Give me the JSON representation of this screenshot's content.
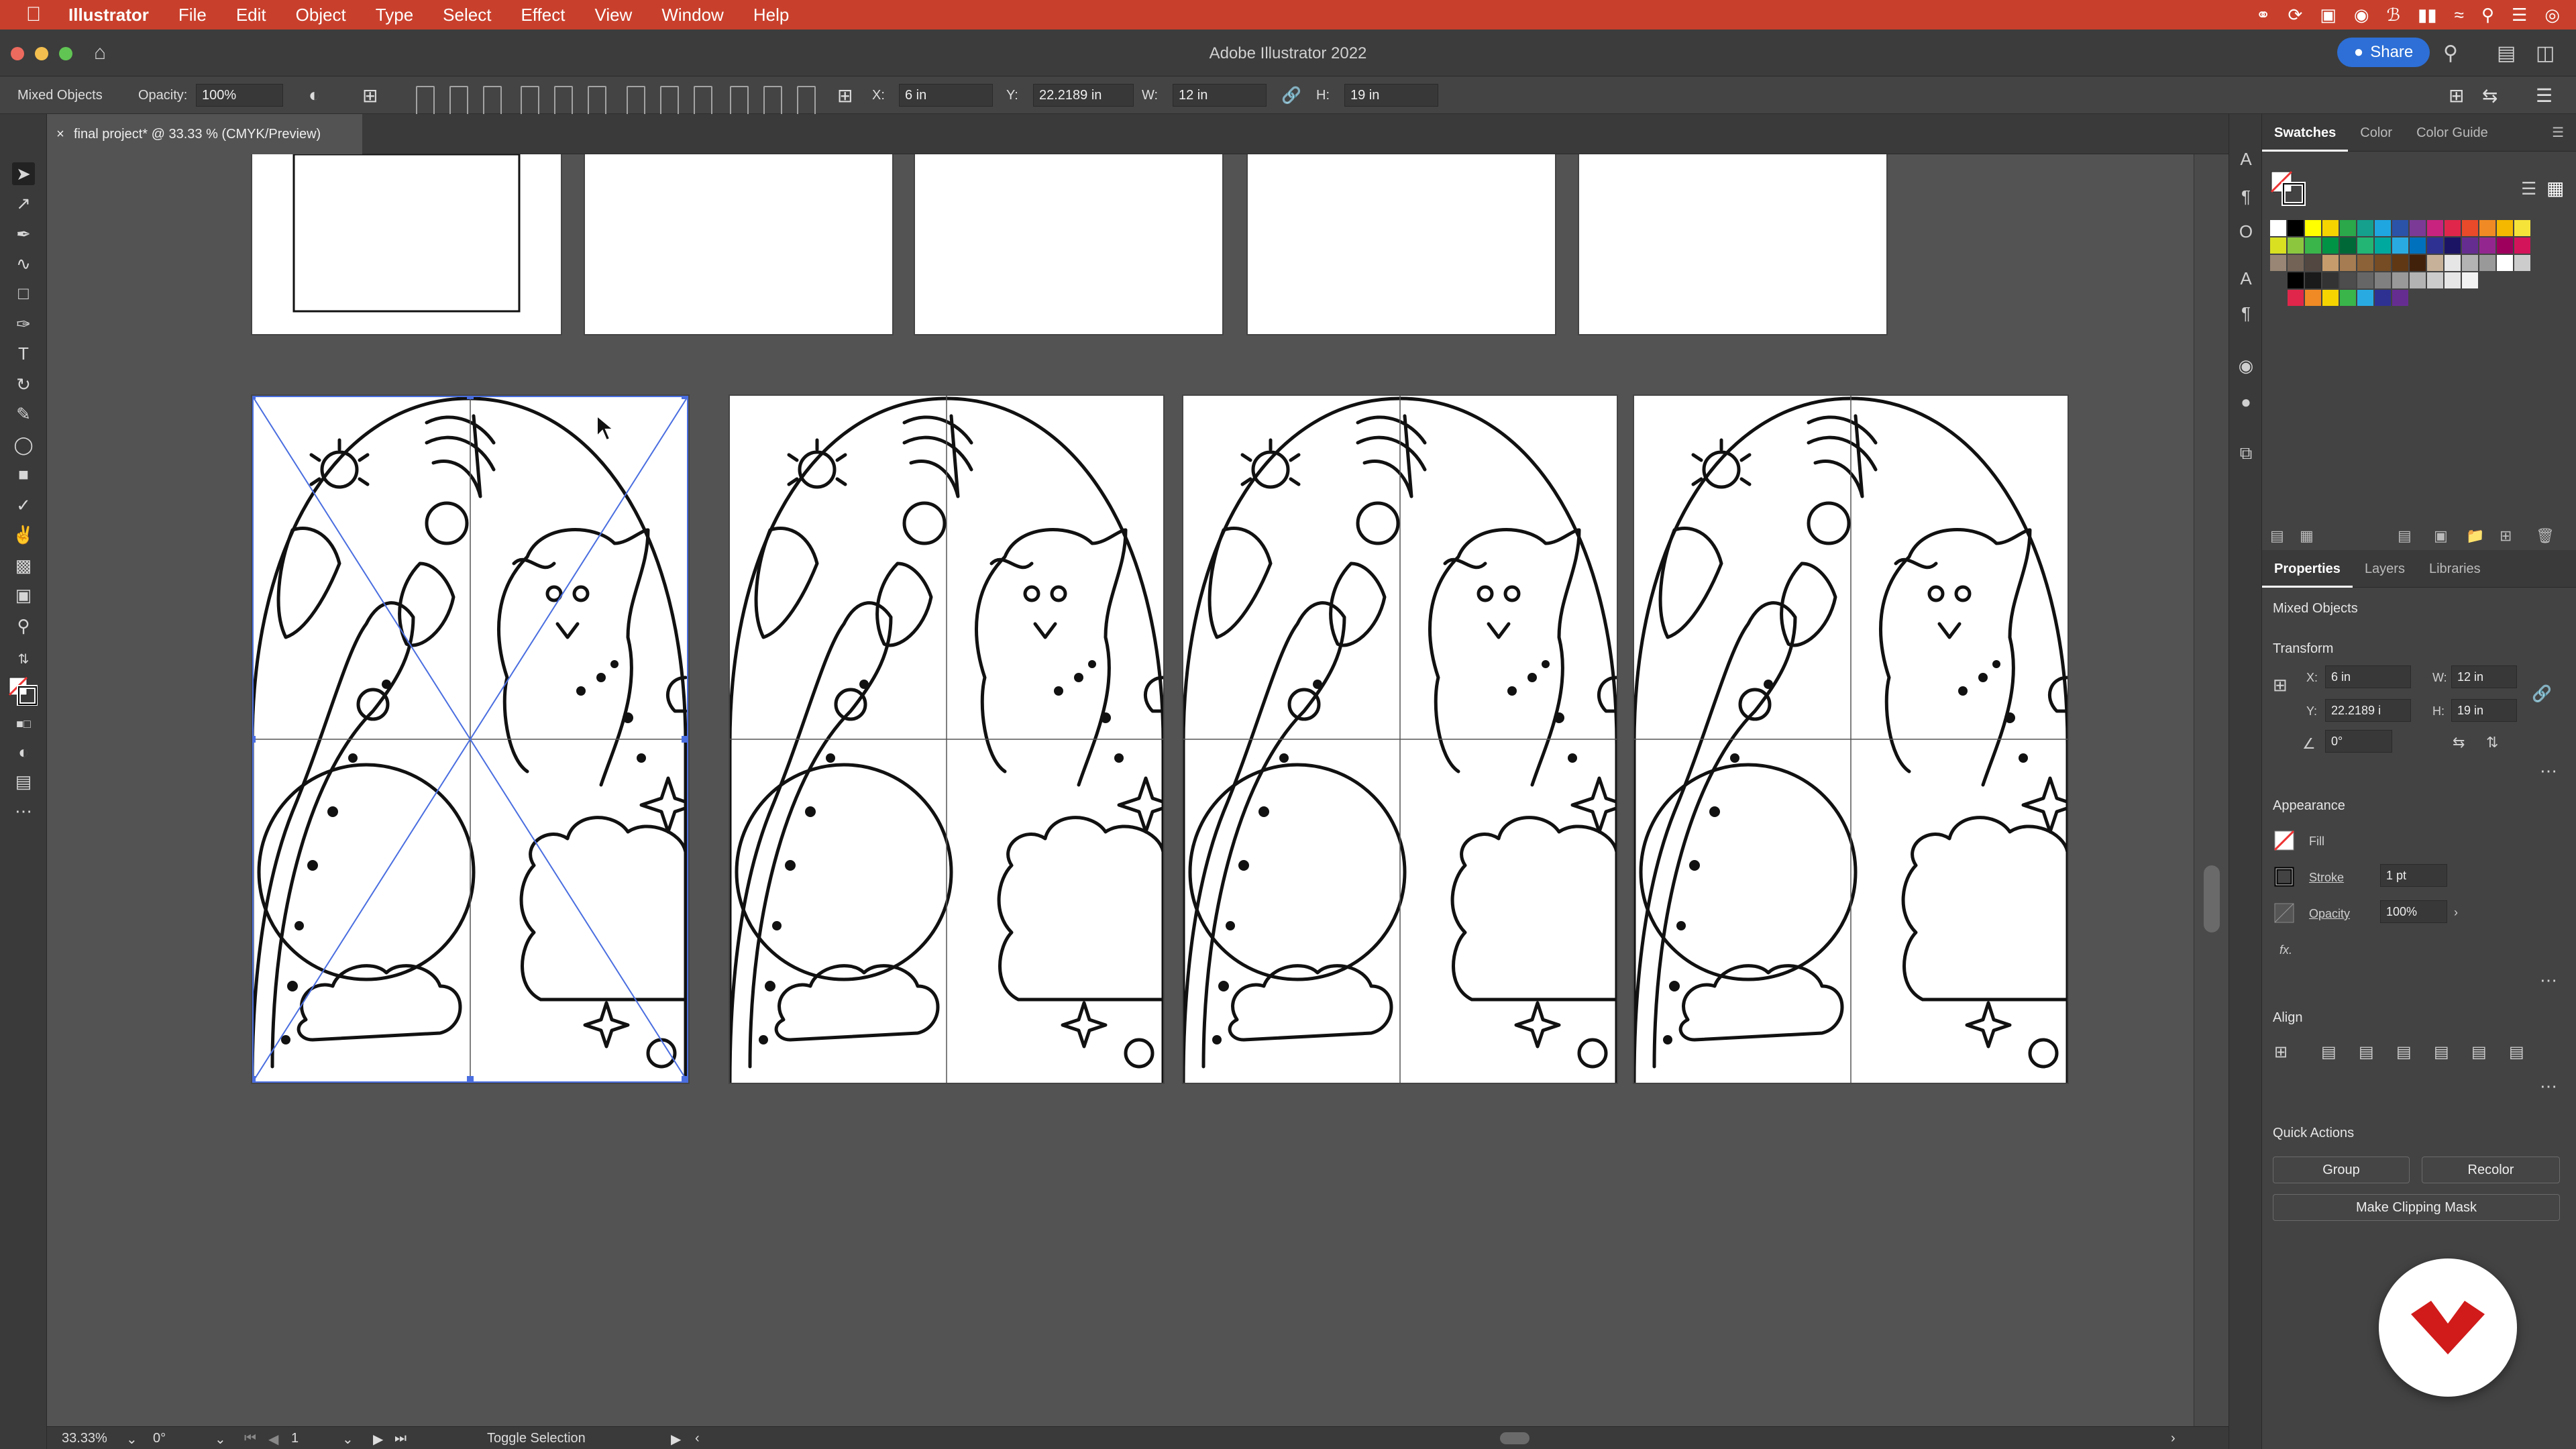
{
  "menubar": {
    "app_name": "Illustrator",
    "items": [
      "File",
      "Edit",
      "Object",
      "Type",
      "Select",
      "Effect",
      "View",
      "Window",
      "Help"
    ]
  },
  "titlebar": {
    "title": "Adobe Illustrator 2022",
    "share_label": "Share"
  },
  "controlbar": {
    "selection_type": "Mixed Objects",
    "opacity_label": "Opacity:",
    "opacity_value": "100%",
    "x_label": "X:",
    "x_value": "6 in",
    "y_label": "Y:",
    "y_value": "22.2189 in",
    "w_label": "W:",
    "w_value": "12 in",
    "h_label": "H:",
    "h_value": "19 in"
  },
  "document": {
    "tab_title": "final project* @ 33.33 % (CMYK/Preview)"
  },
  "swatches_panel": {
    "tabs": [
      "Swatches",
      "Color",
      "Color Guide"
    ],
    "active_tab": "Swatches",
    "colors_row1": [
      "#ffffff",
      "#000000",
      "#ffff00",
      "#f5d400",
      "#2aa84a",
      "#14a08c",
      "#1fa6e0",
      "#2b53a8",
      "#7b3a96",
      "#c8237e",
      "#e0264a",
      "#e84a2a",
      "#f08a24",
      "#f5b800",
      "#f6e33a"
    ],
    "colors_row2": [
      "#d9e021",
      "#8cc63f",
      "#39b54a",
      "#009245",
      "#006837",
      "#22b573",
      "#00a99d",
      "#29abe2",
      "#0071bc",
      "#2e3192",
      "#1b1464",
      "#662d91",
      "#93278f",
      "#9e005d",
      "#d4145a"
    ],
    "colors_row3": [
      "#998675",
      "#736357",
      "#534741",
      "#c69c6d",
      "#a67c52",
      "#8c6239",
      "#754c24",
      "#603813",
      "#42210b",
      "#c7b299",
      "#e6e6e6",
      "#b3b3b3",
      "#999999",
      "#ffffff",
      "#cccccc"
    ],
    "colors_row4": [
      "#000000",
      "#1a1a1a",
      "#333333",
      "#4d4d4d",
      "#666666",
      "#808080",
      "#999999",
      "#b3b3b3",
      "#cccccc",
      "#e6e6e6",
      "#f2f2f2"
    ],
    "colors_row5": [
      "#e0264a",
      "#f08a24",
      "#f5d400",
      "#39b54a",
      "#29abe2",
      "#2e3192",
      "#662d91"
    ]
  },
  "properties_panel": {
    "tabs": [
      "Properties",
      "Layers",
      "Libraries"
    ],
    "active_tab": "Properties",
    "selection_label": "Mixed Objects",
    "transform": {
      "title": "Transform",
      "x_label": "X:",
      "x_value": "6 in",
      "y_label": "Y:",
      "y_value": "22.2189 i",
      "w_label": "W:",
      "w_value": "12 in",
      "h_label": "H:",
      "h_value": "19 in",
      "angle_value": "0°"
    },
    "appearance": {
      "title": "Appearance",
      "fill_label": "Fill",
      "stroke_label": "Stroke",
      "stroke_value": "1 pt",
      "opacity_label": "Opacity",
      "opacity_value": "100%",
      "fx_label": "fx."
    },
    "align": {
      "title": "Align"
    },
    "quick_actions": {
      "title": "Quick Actions",
      "group_label": "Group",
      "recolor_label": "Recolor",
      "clipping_mask_label": "Make Clipping Mask"
    }
  },
  "statusbar": {
    "zoom": "33.33%",
    "rotation": "0°",
    "artboard_number": "1",
    "tool_hint": "Toggle Selection"
  },
  "colors": {
    "menubar_bg": "#c8402c",
    "selection_blue": "#4a6ee0",
    "share_blue": "#2d6fd6",
    "brand_red": "#d11a1a"
  }
}
